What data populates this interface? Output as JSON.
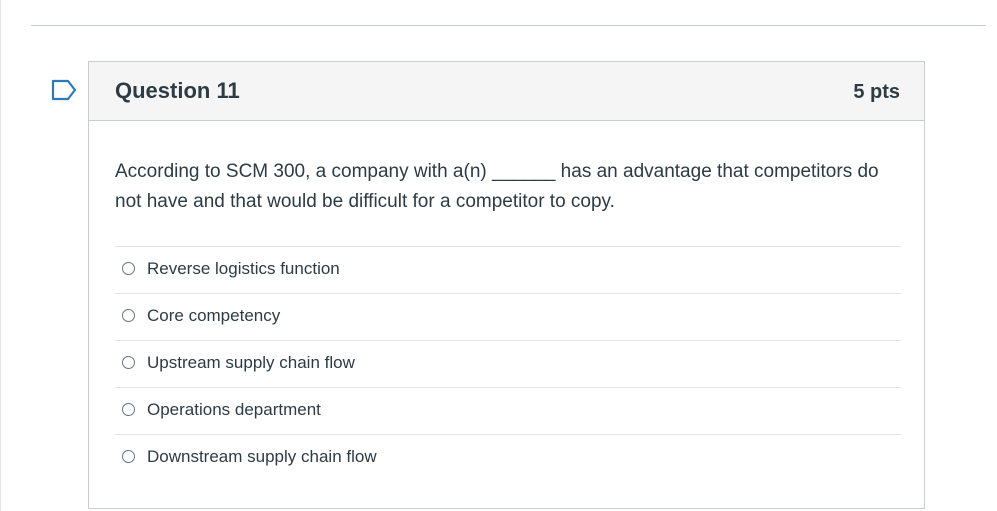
{
  "question": {
    "title": "Question 11",
    "points": "5 pts",
    "text": "According to SCM 300, a company with a(n) ______ has an advantage that competitors do not have and that would be difficult for a competitor to copy.",
    "answers": [
      {
        "label": "Reverse logistics function"
      },
      {
        "label": "Core competency"
      },
      {
        "label": "Upstream supply chain flow"
      },
      {
        "label": "Operations department"
      },
      {
        "label": "Downstream supply chain flow"
      }
    ],
    "flag_icon": "bookmark-flag-icon"
  },
  "colors": {
    "text": "#2d3b45",
    "header_bg": "#f5f5f5",
    "border": "#c7cdd1",
    "flag": "#2b7abc"
  }
}
